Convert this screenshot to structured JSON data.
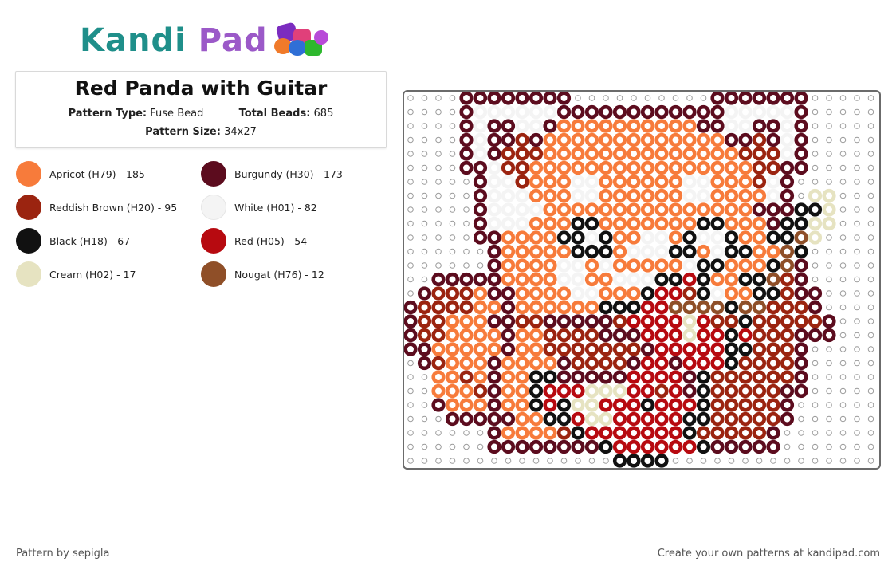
{
  "logo": {
    "part1": "Kandi",
    "part2": " Pad"
  },
  "pattern": {
    "title": "Red Panda with Guitar",
    "type_label": "Pattern Type:",
    "type_value": "Fuse Bead",
    "total_label": "Total Beads:",
    "total_value": "685",
    "size_label": "Pattern Size:",
    "size_value": "34x27"
  },
  "legend": [
    {
      "label": "Apricot (H79) - 185",
      "color": "#f77b3b"
    },
    {
      "label": "Burgundy (H30) - 173",
      "color": "#5c0c1e"
    },
    {
      "label": "Reddish Brown (H20) - 95",
      "color": "#9b2410"
    },
    {
      "label": "White (H01) - 82",
      "color": "#f4f4f4"
    },
    {
      "label": "Black (H18) - 67",
      "color": "#111111"
    },
    {
      "label": "Red (H05) - 54",
      "color": "#b70a10"
    },
    {
      "label": "Cream (H02) - 17",
      "color": "#e6e3c1"
    },
    {
      "label": "Nougat (H76) - 12",
      "color": "#8f4f28"
    }
  ],
  "colors": {
    "brand_teal": "#1f8f8a",
    "brand_purple": "#9b59c8",
    "peg": "#9a9a9a"
  },
  "footer": {
    "credit": "Pattern by sepigla",
    "cta": "Create your own patterns at kandipad.com"
  }
}
